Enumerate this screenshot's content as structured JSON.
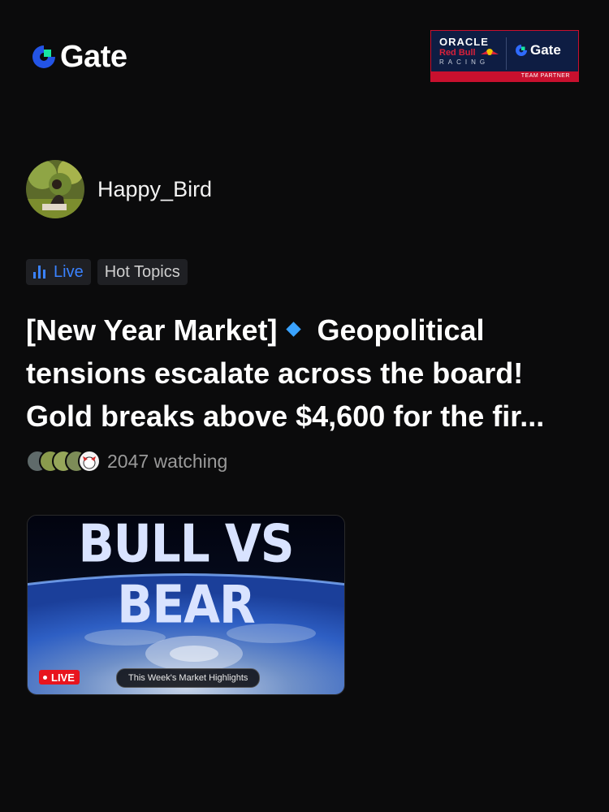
{
  "header": {
    "brand_name": "Gate",
    "brand_accent_color": "#2354e6",
    "brand_green_color": "#17e5a2",
    "partner": {
      "oracle": "ORACLE",
      "redbull": "Red Bull",
      "racing": "RACING",
      "gate": "Gate",
      "team_label": "TEAM PARTNER"
    }
  },
  "author": {
    "name": "Happy_Bird",
    "avatar": "avatar-image"
  },
  "tags": [
    {
      "label": "Live",
      "icon": "live-bars-icon",
      "color": "#3a82ff"
    },
    {
      "label": "Hot Topics"
    }
  ],
  "post": {
    "title_part1": "[New Year Market]",
    "title_part2": "Geopolitical tensions escalate across the board! Gold breaks above $4,600 for the fir...",
    "title_icon": "blue-diamond-icon"
  },
  "watchers": {
    "count_text": "2047 watching",
    "avatar_count": 5
  },
  "thumbnail": {
    "headline": "BULL VS BEAR",
    "live_badge": "LIVE",
    "caption": "This Week's Market Highlights"
  }
}
